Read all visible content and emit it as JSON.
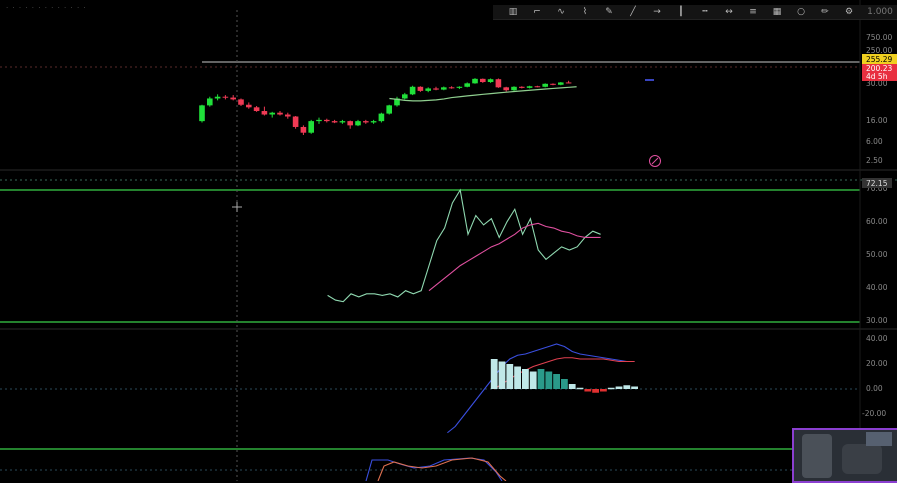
{
  "header": {
    "title": "· · · · · · · · · · · · ·"
  },
  "toolbar": {
    "icons": [
      "bars-icon",
      "step-icon",
      "curve-icon",
      "brush-icon",
      "pen-icon",
      "line-icon",
      "ray-icon",
      "vline-icon",
      "hline-icon",
      "arrows-icon",
      "fib-icon",
      "grid-icon",
      "circle-icon",
      "pencil-icon",
      "settings-icon"
    ],
    "label": "1.000"
  },
  "colors": {
    "up": "#20e03a",
    "down": "#f03a55",
    "ma": "#8fcf8f",
    "rsi": "#8fd8b0",
    "rsi_ma": "#e050a0",
    "macd": "#3a4fe0",
    "signal": "#e04050",
    "hist_pos": "#bfe8e8",
    "hist_neg": "#e03030",
    "accent": "#8b3fd0",
    "axis": "#888888"
  },
  "price_axis": {
    "ticks": [
      "750.00",
      "250.00",
      "90.00",
      "30.00",
      "16.00",
      "6.00",
      "2.50"
    ]
  },
  "price_labels": {
    "resistance": "255.29",
    "last": "200.23",
    "countdown": "4d 5h"
  },
  "rsi_axis": {
    "ticks": [
      "70.00",
      "60.00",
      "50.00",
      "40.00",
      "30.00"
    ],
    "current": "72.15"
  },
  "macd_axis": {
    "ticks": [
      "40.00",
      "20.00",
      "0.00",
      "-20.00"
    ]
  },
  "chart_data": [
    {
      "type": "candlestick",
      "scale": "log",
      "levels": {
        "resistance": 255.29
      },
      "candles": [
        {
          "o": 17,
          "h": 36,
          "l": 16,
          "c": 35
        },
        {
          "o": 35,
          "h": 52,
          "l": 33,
          "c": 48
        },
        {
          "o": 48,
          "h": 58,
          "l": 44,
          "c": 52
        },
        {
          "o": 52,
          "h": 56,
          "l": 46,
          "c": 50
        },
        {
          "o": 50,
          "h": 56,
          "l": 44,
          "c": 46
        },
        {
          "o": 46,
          "h": 48,
          "l": 34,
          "c": 36
        },
        {
          "o": 36,
          "h": 40,
          "l": 30,
          "c": 32
        },
        {
          "o": 32,
          "h": 34,
          "l": 26,
          "c": 27
        },
        {
          "o": 27,
          "h": 33,
          "l": 22,
          "c": 23
        },
        {
          "o": 23,
          "h": 26,
          "l": 20,
          "c": 25
        },
        {
          "o": 25,
          "h": 27,
          "l": 22,
          "c": 23
        },
        {
          "o": 23,
          "h": 25,
          "l": 19,
          "c": 21
        },
        {
          "o": 21,
          "h": 21.5,
          "l": 12,
          "c": 13
        },
        {
          "o": 13,
          "h": 14,
          "l": 9,
          "c": 10
        },
        {
          "o": 10,
          "h": 18,
          "l": 9.5,
          "c": 17
        },
        {
          "o": 17,
          "h": 20,
          "l": 15,
          "c": 18
        },
        {
          "o": 18,
          "h": 19,
          "l": 16,
          "c": 17
        },
        {
          "o": 17,
          "h": 18,
          "l": 15.5,
          "c": 16
        },
        {
          "o": 16,
          "h": 18,
          "l": 15,
          "c": 17
        },
        {
          "o": 17,
          "h": 17.5,
          "l": 12,
          "c": 14
        },
        {
          "o": 14,
          "h": 18,
          "l": 13.5,
          "c": 17
        },
        {
          "o": 17,
          "h": 18,
          "l": 15,
          "c": 16
        },
        {
          "o": 16,
          "h": 18,
          "l": 15,
          "c": 17
        },
        {
          "o": 17,
          "h": 25,
          "l": 16,
          "c": 24
        },
        {
          "o": 24,
          "h": 36,
          "l": 23,
          "c": 35
        },
        {
          "o": 35,
          "h": 52,
          "l": 33,
          "c": 48
        },
        {
          "o": 48,
          "h": 62,
          "l": 46,
          "c": 58
        },
        {
          "o": 58,
          "h": 86,
          "l": 56,
          "c": 82
        },
        {
          "o": 82,
          "h": 84,
          "l": 65,
          "c": 68
        },
        {
          "o": 68,
          "h": 80,
          "l": 64,
          "c": 76
        },
        {
          "o": 76,
          "h": 82,
          "l": 70,
          "c": 72
        },
        {
          "o": 72,
          "h": 83,
          "l": 70,
          "c": 80
        },
        {
          "o": 80,
          "h": 84,
          "l": 75,
          "c": 78
        },
        {
          "o": 78,
          "h": 84,
          "l": 74,
          "c": 82
        },
        {
          "o": 82,
          "h": 100,
          "l": 80,
          "c": 96
        },
        {
          "o": 96,
          "h": 122,
          "l": 94,
          "c": 118
        },
        {
          "o": 118,
          "h": 120,
          "l": 98,
          "c": 102
        },
        {
          "o": 102,
          "h": 120,
          "l": 98,
          "c": 116
        },
        {
          "o": 116,
          "h": 120,
          "l": 78,
          "c": 80
        },
        {
          "o": 80,
          "h": 82,
          "l": 66,
          "c": 70
        },
        {
          "o": 70,
          "h": 84,
          "l": 68,
          "c": 82
        },
        {
          "o": 82,
          "h": 84,
          "l": 76,
          "c": 78
        },
        {
          "o": 78,
          "h": 86,
          "l": 76,
          "c": 84
        },
        {
          "o": 84,
          "h": 86,
          "l": 80,
          "c": 82
        },
        {
          "o": 82,
          "h": 96,
          "l": 80,
          "c": 94
        },
        {
          "o": 94,
          "h": 96,
          "l": 88,
          "c": 90
        },
        {
          "o": 90,
          "h": 102,
          "l": 88,
          "c": 100
        },
        {
          "o": 100,
          "h": 108,
          "l": 96,
          "c": 98
        }
      ],
      "ma": [
        null,
        null,
        null,
        null,
        null,
        null,
        null,
        null,
        null,
        null,
        null,
        null,
        null,
        null,
        null,
        null,
        null,
        null,
        null,
        null,
        null,
        null,
        null,
        48,
        46,
        44,
        43,
        43,
        44,
        45,
        47,
        50,
        52,
        54,
        56,
        58,
        60,
        62,
        64,
        66,
        68,
        70,
        72,
        74,
        76,
        78,
        80,
        82
      ]
    },
    {
      "type": "line",
      "name_hidden": true,
      "ylim": [
        28,
        74
      ],
      "series": [
        {
          "key": "rsi",
          "values": [
            null,
            null,
            null,
            null,
            null,
            null,
            null,
            null,
            null,
            null,
            null,
            null,
            38.5,
            37,
            36.5,
            39,
            38,
            39,
            39,
            38.5,
            39,
            38,
            40,
            39,
            40,
            48,
            56,
            60,
            68,
            72.15,
            58,
            64,
            61,
            63,
            57,
            62,
            66,
            58,
            63,
            53,
            50,
            52,
            54,
            53,
            54,
            57,
            59,
            58
          ]
        },
        {
          "key": "rsi_ma",
          "values": [
            null,
            null,
            null,
            null,
            null,
            null,
            null,
            null,
            null,
            null,
            null,
            null,
            null,
            null,
            null,
            null,
            null,
            null,
            null,
            null,
            null,
            null,
            null,
            null,
            null,
            40,
            42,
            44,
            46,
            48,
            49.5,
            51,
            52.5,
            54,
            55,
            56.5,
            58,
            60,
            61,
            61.5,
            60.5,
            60,
            59,
            58.5,
            57.5,
            57,
            57,
            57
          ]
        }
      ]
    },
    {
      "type": "line+bar",
      "ylim": [
        -30,
        45
      ],
      "series": [
        {
          "key": "macd",
          "values": [
            null,
            null,
            null,
            null,
            null,
            null,
            null,
            null,
            null,
            null,
            null,
            null,
            null,
            null,
            null,
            null,
            null,
            null,
            null,
            null,
            null,
            null,
            null,
            -35,
            -30,
            -22,
            -14,
            -6,
            2,
            10,
            18,
            24,
            27,
            28,
            30,
            32,
            34,
            36,
            34,
            30,
            28,
            27,
            26,
            25,
            24,
            23,
            22,
            22
          ]
        },
        {
          "key": "signal",
          "values": [
            null,
            null,
            null,
            null,
            null,
            null,
            null,
            null,
            null,
            null,
            null,
            null,
            null,
            null,
            null,
            null,
            null,
            null,
            null,
            null,
            null,
            null,
            null,
            null,
            null,
            null,
            null,
            null,
            null,
            0,
            4,
            8,
            12,
            15,
            18,
            20,
            22,
            24,
            25,
            25,
            24,
            24,
            24,
            24,
            23,
            22,
            22,
            22
          ]
        },
        {
          "key": "hist",
          "values": [
            null,
            null,
            null,
            null,
            null,
            null,
            null,
            null,
            null,
            null,
            null,
            null,
            null,
            null,
            null,
            null,
            null,
            null,
            null,
            null,
            null,
            null,
            null,
            null,
            null,
            null,
            null,
            null,
            null,
            24,
            22,
            20,
            18,
            16,
            14,
            16,
            14,
            12,
            8,
            4,
            1,
            -2,
            -3,
            -2,
            1,
            2,
            3,
            2
          ]
        }
      ]
    }
  ]
}
